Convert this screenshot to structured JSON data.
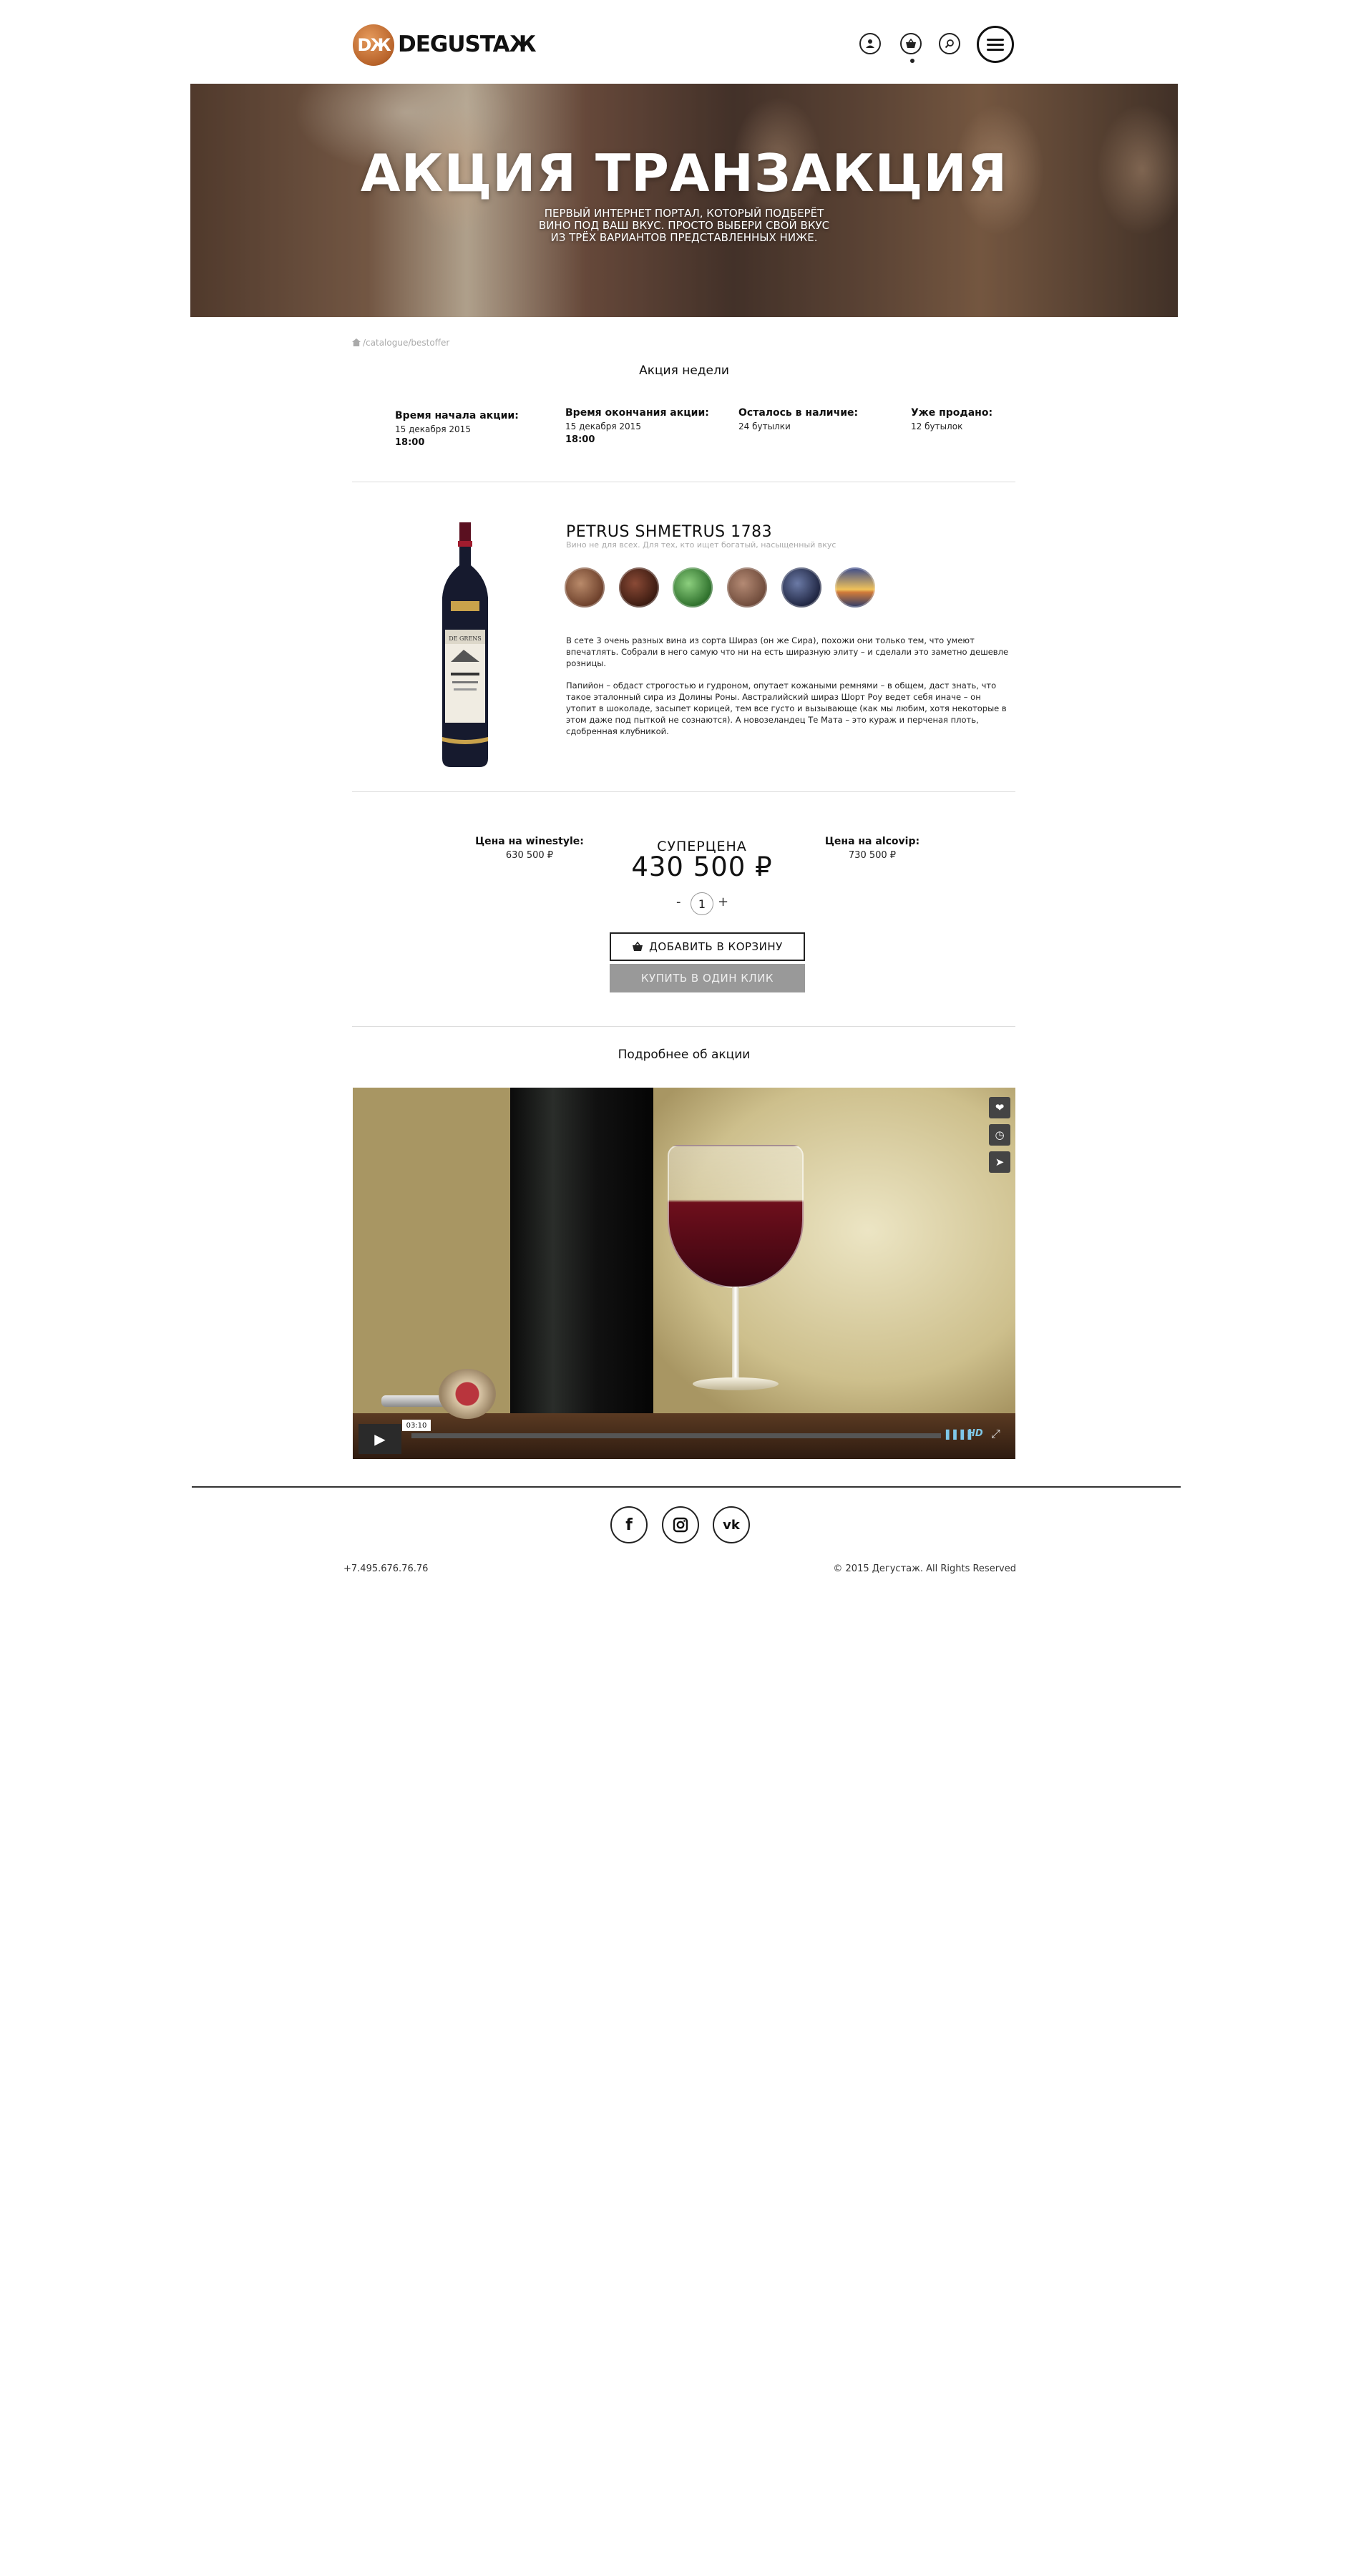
{
  "header": {
    "logo_mark": "DЖ",
    "logo_text": "DEGUSTAЖ",
    "icons": [
      "user-icon",
      "basket-icon",
      "search-icon",
      "menu-icon"
    ]
  },
  "hero": {
    "title": "АКЦИЯ ТРАНЗАКЦИЯ",
    "subtitle": "ПЕРВЫЙ ИНТЕРНЕТ ПОРТАЛ, КОТОРЫЙ ПОДБЕРЁТ ВИНО ПОД ВАШ ВКУС. ПРОСТО ВЫБЕРИ СВОЙ ВКУС ИЗ ТРЁХ ВАРИАНТОВ ПРЕДСТАВЛЕННЫХ НИЖЕ."
  },
  "breadcrumb": "/catalogue/bestoffer",
  "promo": {
    "title": "Акция недели",
    "stats": [
      {
        "label": "Время начала акции:",
        "date": "15 декабря 2015",
        "time": "18:00"
      },
      {
        "label": "Время окончания акции:",
        "date": "15 декабря 2015",
        "time": "18:00"
      },
      {
        "label": "Осталось в наличие:",
        "date": "24 бутылки",
        "time": ""
      },
      {
        "label": "Уже продано:",
        "date": "12 бутылок",
        "time": ""
      }
    ]
  },
  "product": {
    "name": "PETRUS SHMETRUS 1783",
    "tagline": "Вино не для всех. Для тех, кто ищет богатый, насыщенный вкус",
    "bottle_label": "DE GRENS",
    "aromas": [
      "spice-aroma",
      "coffee-aroma",
      "herb-aroma",
      "cocoa-aroma",
      "blueberry-aroma",
      "sunset-aroma"
    ],
    "desc1": "В сете 3 очень разных вина из сорта Шираз (он же Сира), похожи они только тем, что умеют впечатлять. Собрали в него самую что ни на есть ширазную элиту – и сделали это заметно дешевле розницы.",
    "desc2": "Папийон – обдаст строгостью и гудроном, опутает кожаными ремнями – в общем, даст знать, что такое эталонный сира из Долины Роны. Австралийский шираз Шорт Роу ведет себя иначе – он утопит в шоколаде, засыпет корицей, тем все густо и вызывающе (как мы любим, хотя некоторые в этом даже под пыткой не сознаются). А новозеландец Те Мата – это кураж и перченая плоть, сдобренная клубникой."
  },
  "pricing": {
    "left_label": "Цена на winestyle:",
    "left_value": "630 500 ₽",
    "super_label": "СУПЕРЦЕНА",
    "super_value": "430 500 ₽",
    "right_label": "Цена на alcovip:",
    "right_value": "730 500 ₽",
    "qty_minus": "-",
    "qty_value": "1",
    "qty_plus": "+",
    "add_to_cart": "ДОБАВИТЬ В КОРЗИНУ",
    "buy_one_click": "КУПИТЬ В ОДИН КЛИК"
  },
  "details": {
    "title": "Подробнее об акции",
    "video_time": "03:10",
    "video_hd": "HD",
    "progress": 0.0
  },
  "footer": {
    "phone": "+7.495.676.76.76",
    "copyright": "© 2015 Дегустаж. All Rights Reserved",
    "social": [
      "facebook-icon",
      "instagram-icon",
      "vk-icon"
    ]
  },
  "colors": {
    "logo": "#c06a2e",
    "buy_button": "#999999",
    "video_accent": "#7fc8e8"
  }
}
